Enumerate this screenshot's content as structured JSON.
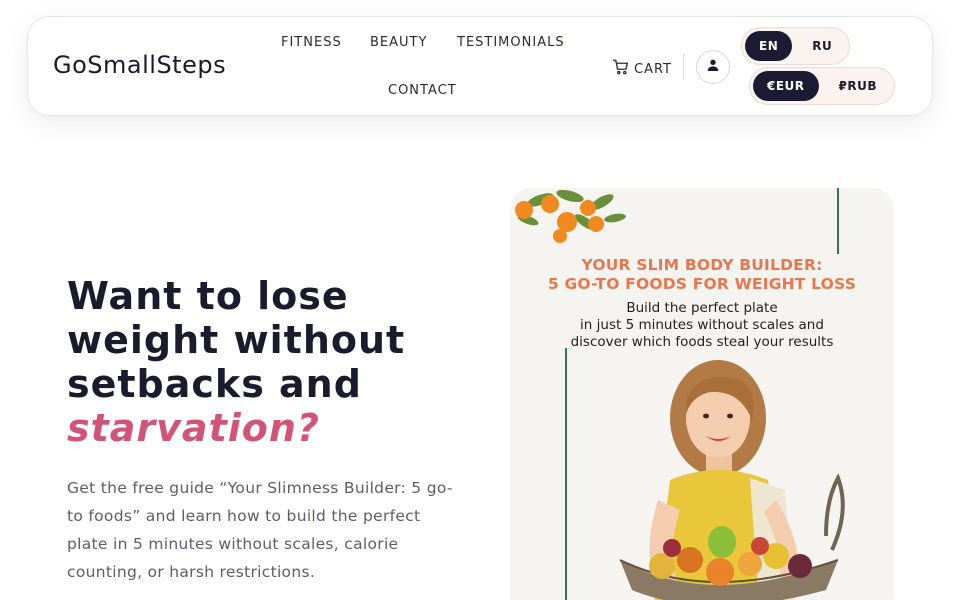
{
  "header": {
    "logo": "GoSmallSteps",
    "nav": [
      "FITNESS",
      "BEAUTY",
      "TESTIMONIALS",
      "CONTACT"
    ],
    "cart_label": "CART",
    "language": {
      "options": [
        "EN",
        "RU"
      ],
      "active": "EN"
    },
    "currency": {
      "options": [
        "€EUR",
        "₽RUB"
      ],
      "active": "€EUR"
    }
  },
  "hero": {
    "title": "Want to lose weight without setbacks and",
    "title_accent": "starvation?",
    "description": "Get the free guide “Your Slimness Builder: 5 go-to foods” and learn how to build the perfect plate in 5 minutes without scales, calorie counting, or harsh restrictions."
  },
  "guide_card": {
    "title_line1": "YOUR SLIM BODY BUILDER:",
    "title_line2": "5 GO-TO FOODS FOR WEIGHT LOSS",
    "subtitle_line1": "Build the perfect plate",
    "subtitle_line2": "in just 5 minutes without scales and",
    "subtitle_line3": "discover which foods steal your results"
  },
  "colors": {
    "accent": "#d25577",
    "dark": "#1d1b33",
    "card_title": "#e8774d",
    "green_line": "#2f7a55"
  },
  "icons": {
    "cart": "cart-icon",
    "account": "user-icon"
  }
}
